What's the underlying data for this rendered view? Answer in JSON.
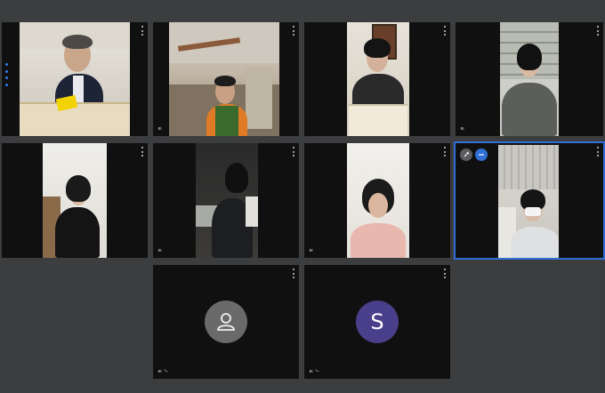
{
  "meeting": {
    "participants": [
      {
        "name": "",
        "type": "video"
      },
      {
        "name": "ㅌ",
        "type": "video"
      },
      {
        "name": "",
        "type": "video"
      },
      {
        "name": "ㅌ",
        "type": "video"
      },
      {
        "name": "",
        "type": "video"
      },
      {
        "name": "ㅌ",
        "type": "video"
      },
      {
        "name": "ㅌ",
        "type": "video"
      },
      {
        "name": "",
        "type": "video",
        "active_speaker": true
      },
      {
        "name": "ㅌ ᄂ",
        "type": "avatar",
        "avatar_icon": "person-icon",
        "avatar_color": "#6a6a6a"
      },
      {
        "name": "ㅌ ᄂ",
        "type": "avatar",
        "avatar_letter": "S",
        "avatar_color": "#4a3f8a"
      }
    ],
    "colors": {
      "background": "#3c3d3f",
      "tile": "#101010",
      "active_border": "#2f6fd6"
    }
  }
}
